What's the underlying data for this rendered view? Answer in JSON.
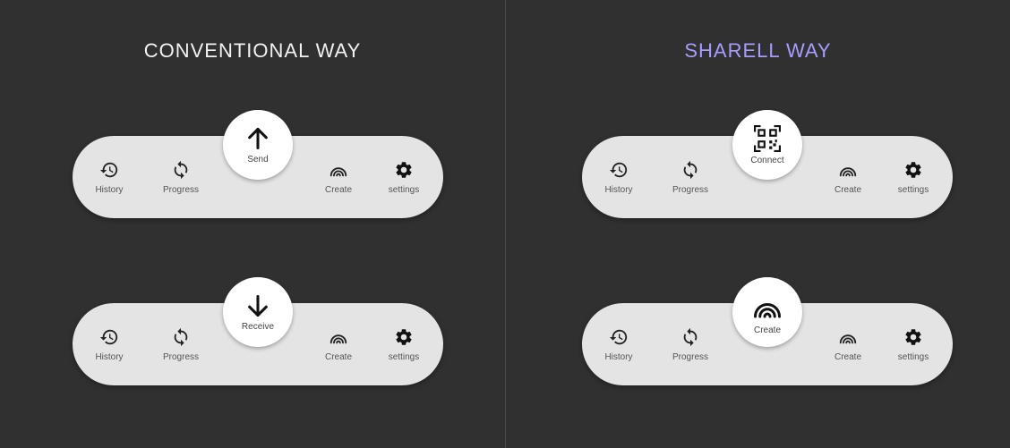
{
  "left": {
    "title": "CONVENTIONAL WAY",
    "bars": [
      {
        "center": {
          "label": "Send",
          "icon": "arrow-up-icon"
        },
        "items": [
          {
            "label": "History",
            "icon": "history-icon"
          },
          {
            "label": "Progress",
            "icon": "sync-icon"
          },
          {
            "label": "Create",
            "icon": "broadcast-icon"
          },
          {
            "label": "settings",
            "icon": "gear-icon"
          }
        ]
      },
      {
        "center": {
          "label": "Receive",
          "icon": "arrow-down-icon"
        },
        "items": [
          {
            "label": "History",
            "icon": "history-icon"
          },
          {
            "label": "Progress",
            "icon": "sync-icon"
          },
          {
            "label": "Create",
            "icon": "broadcast-icon"
          },
          {
            "label": "settings",
            "icon": "gear-icon"
          }
        ]
      }
    ]
  },
  "right": {
    "title": "SHARELL WAY",
    "bars": [
      {
        "center": {
          "label": "Connect",
          "icon": "qr-code-icon"
        },
        "items": [
          {
            "label": "History",
            "icon": "history-icon"
          },
          {
            "label": "Progress",
            "icon": "sync-icon"
          },
          {
            "label": "Create",
            "icon": "broadcast-icon"
          },
          {
            "label": "settings",
            "icon": "gear-icon"
          }
        ]
      },
      {
        "center": {
          "label": "Create",
          "icon": "broadcast-icon"
        },
        "items": [
          {
            "label": "History",
            "icon": "history-icon"
          },
          {
            "label": "Progress",
            "icon": "sync-icon"
          },
          {
            "label": "Create",
            "icon": "broadcast-icon"
          },
          {
            "label": "settings",
            "icon": "gear-icon"
          }
        ]
      }
    ]
  },
  "colors": {
    "background": "#303030",
    "bar": "#e4e4e4",
    "accent": "#a79cff",
    "title": "#f2f2f2"
  }
}
